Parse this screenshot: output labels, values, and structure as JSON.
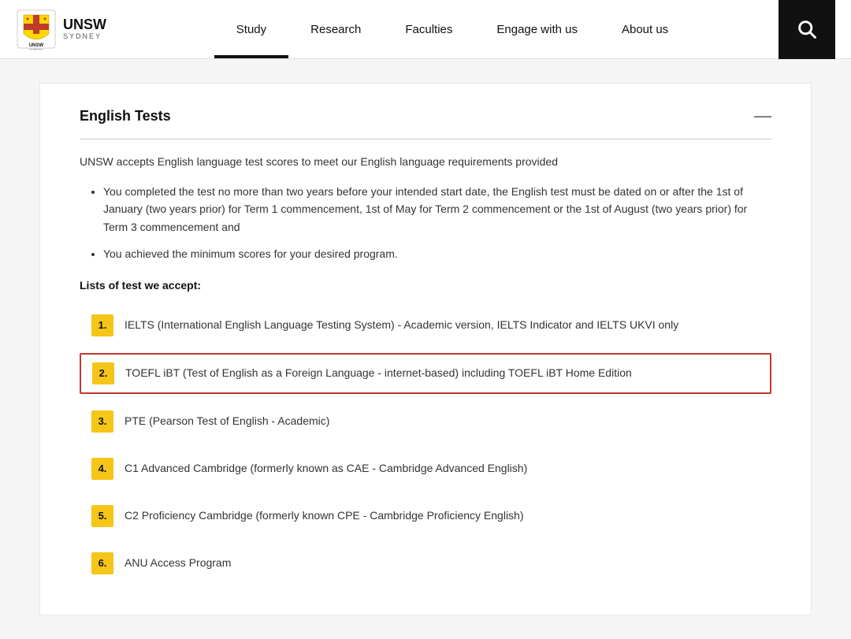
{
  "header": {
    "logo_alt": "UNSW Sydney",
    "nav_items": [
      {
        "label": "Study",
        "active": true
      },
      {
        "label": "Research",
        "active": false
      },
      {
        "label": "Faculties",
        "active": false
      },
      {
        "label": "Engage with us",
        "active": false
      },
      {
        "label": "About us",
        "active": false
      }
    ],
    "search_label": "Search"
  },
  "section": {
    "title": "English Tests",
    "collapse_icon": "—",
    "intro": "UNSW accepts English language test scores to meet our English language requirements provided",
    "bullets": [
      "You completed the test no more than two years before your intended start date, the English test must be dated on or after the 1st of January (two years prior) for Term 1 commencement, 1st of May for Term 2  commencement or the 1st of August (two years prior) for Term 3 commencement and",
      "You achieved the minimum scores for your desired program."
    ],
    "lists_label": "Lists of test we accept:",
    "tests": [
      {
        "number": "1.",
        "text": "IELTS (International English Language Testing System) - Academic version, IELTS Indicator and IELTS UKVI only",
        "highlighted": false
      },
      {
        "number": "2.",
        "text": "TOEFL iBT (Test of English as a Foreign Language - internet-based) including TOEFL iBT Home Edition",
        "highlighted": true
      },
      {
        "number": "3.",
        "text": "PTE (Pearson Test of English - Academic)",
        "highlighted": false
      },
      {
        "number": "4.",
        "text": "C1 Advanced Cambridge (formerly known as CAE - Cambridge Advanced English)",
        "highlighted": false
      },
      {
        "number": "5.",
        "text": "C2 Proficiency Cambridge (formerly known CPE - Cambridge Proficiency English)",
        "highlighted": false
      },
      {
        "number": "6.",
        "text": "ANU Access Program",
        "highlighted": false
      }
    ]
  }
}
